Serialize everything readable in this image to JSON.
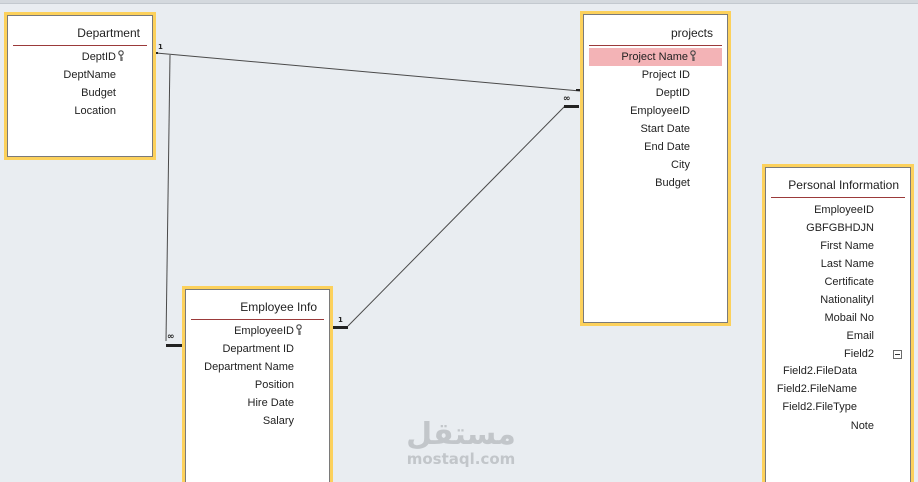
{
  "tables": {
    "department": {
      "title": "Department",
      "fields": [
        "DeptID",
        "DeptName",
        "Budget",
        "Location"
      ],
      "key_field": "DeptID"
    },
    "projects": {
      "title": "projects",
      "fields": [
        "Project Name",
        "Project ID",
        "DeptID",
        "EmployeeID",
        "Start Date",
        "End Date",
        "City",
        "Budget"
      ],
      "key_field": "Project Name",
      "selected_field": "Project Name"
    },
    "employee_info": {
      "title": "Employee Info",
      "fields": [
        "EmployeeID",
        "Department ID",
        "Department Name",
        "Position",
        "Hire Date",
        "Salary"
      ],
      "key_field": "EmployeeID"
    },
    "personal_information": {
      "title": "Personal Information",
      "fields": [
        "EmployeeID",
        "GBFGBHDJN",
        "First Name",
        "Last Name",
        "Certificate",
        "Nationalityl",
        "Mobail No",
        "Email",
        "Field2"
      ],
      "subfields": [
        "Field2.FileData",
        "Field2.FileName",
        "Field2.FileType"
      ],
      "after_subfields": [
        "Note"
      ]
    }
  },
  "relationships": {
    "one_label": "1",
    "many_label": "∞"
  },
  "watermark": {
    "arabic": "مستقل",
    "latin": "mostaql.com"
  },
  "colors": {
    "canvas": "#e9edf1",
    "table_border": "#fcd15c",
    "selected_row": "#f3b3b6",
    "header_rule": "#9b3a3a"
  },
  "icons": {
    "primary_key": "key-icon",
    "collapse": "minus-box-icon"
  }
}
